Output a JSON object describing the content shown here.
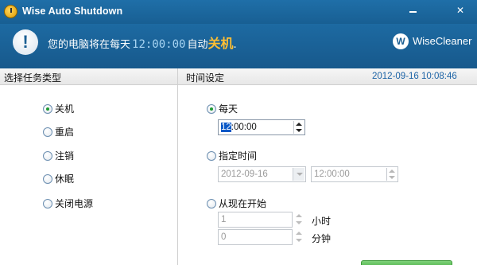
{
  "window": {
    "title": "Wise Auto Shutdown"
  },
  "banner": {
    "prefix": "您的电脑将在每天",
    "time": "12:00:00",
    "middle": "自动",
    "action": "关机",
    "suffix": ".",
    "brand": "WiseCleaner",
    "brand_logo_letter": "W"
  },
  "task_panel": {
    "header": "选择任务类型",
    "options": [
      {
        "label": "关机",
        "selected": true
      },
      {
        "label": "重启",
        "selected": false
      },
      {
        "label": "注销",
        "selected": false
      },
      {
        "label": "休眠",
        "selected": false
      },
      {
        "label": "关闭电源",
        "selected": false
      }
    ]
  },
  "time_panel": {
    "header": "时间设定",
    "clock": "2012-09-16  10:08:46",
    "daily": {
      "label": "每天",
      "selected": true,
      "time_selected_part": "12",
      "time_rest": ":00:00"
    },
    "specified": {
      "label": "指定时间",
      "selected": false,
      "date_value": "2012-09-16",
      "time_value": "12:00:00"
    },
    "from_now": {
      "label": "从现在开始",
      "selected": false,
      "hours_value": "1",
      "hours_unit": "小时",
      "minutes_value": "0",
      "minutes_unit": "分钟"
    }
  },
  "colors": {
    "titlebar": "#1f6fa8",
    "banner": "#17598c",
    "time_text": "#a7d4f2",
    "action_text": "#ffbf33",
    "clock_text": "#1d64a6",
    "radio_selected": "#1e9a32"
  },
  "icons": {
    "app": "clock-icon",
    "banner": "exclamation-icon",
    "minimize": "minimize-icon",
    "close": "close-icon"
  }
}
